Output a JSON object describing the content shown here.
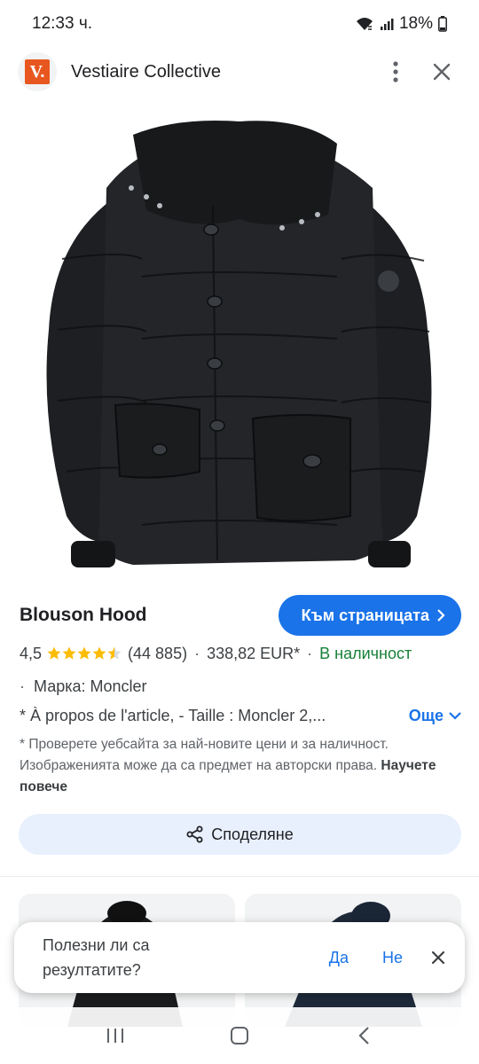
{
  "status_bar": {
    "time": "12:33 ч.",
    "battery": "18%"
  },
  "header": {
    "site_name": "Vestiaire Collective",
    "logo_letter": "V."
  },
  "product": {
    "title": "Blouson Hood",
    "visit_button": "Към страницата",
    "rating": "4,5",
    "rating_value": 4.5,
    "review_count": "(44 885)",
    "price": "338,82 EUR*",
    "stock": "В наличност",
    "brand": "Марка: Moncler",
    "about": "* À propos de l'article, - Taille : Moncler 2,...",
    "more": "Още",
    "disclaimer": "* Проверете уебсайта за най-новите цени и за наличност. Изображенията може да са предмет на авторски права.",
    "learn_more": "Научете повече",
    "share": "Споделяне"
  },
  "feedback": {
    "question": "Полезни ли са резултатите?",
    "yes": "Да",
    "no": "Не"
  },
  "colors": {
    "accent": "#1a73e8",
    "in_stock": "#188038",
    "star": "#fbbc04",
    "logo_orange": "#e8571f"
  }
}
